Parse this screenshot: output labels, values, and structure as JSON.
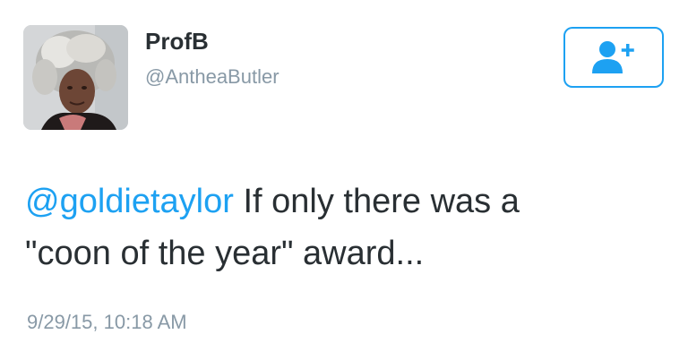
{
  "profile": {
    "display_name": "ProfB",
    "handle": "@AntheaButler"
  },
  "follow_button": {
    "icon": "follow-user-icon"
  },
  "tweet": {
    "mention": "@goldietaylor",
    "line1_rest": " If only there was a",
    "line2": "\"coon of the year\" award..."
  },
  "timestamp": "9/29/15, 10:18 AM",
  "colors": {
    "accent": "#1da1f2",
    "text": "#292f33",
    "secondary_text": "#8899a6"
  }
}
